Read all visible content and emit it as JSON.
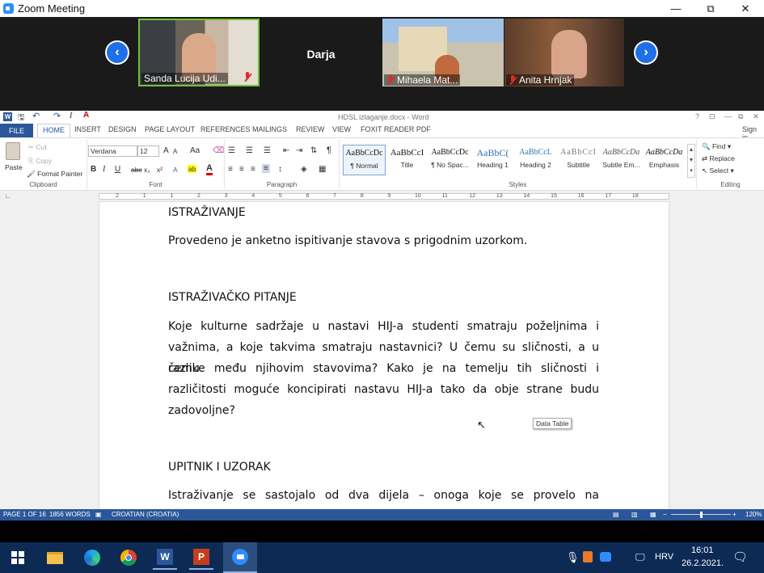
{
  "zoom": {
    "window_title": "Zoom Meeting",
    "participants": [
      {
        "name": "Sanda Lucija Udi...",
        "muted": true
      },
      {
        "name": "Darja",
        "muted": false
      },
      {
        "name": "Mihaela Mat...",
        "muted": true
      },
      {
        "name": "Anita Hrnjak",
        "muted": true
      }
    ],
    "win_controls": {
      "minimize": "—",
      "restore": "⧉",
      "close": "✕"
    }
  },
  "word": {
    "title": "HDSL izlaganje.docx - Word",
    "signin": "Sign in",
    "title_controls": {
      "help": "?",
      "ribbon_opts": "⊡",
      "minimize": "—",
      "restore": "⧉",
      "close": "✕"
    },
    "tabs": {
      "file": "FILE",
      "home": "HOME",
      "insert": "INSERT",
      "design": "DESIGN",
      "page_layout": "PAGE LAYOUT",
      "references": "REFERENCES",
      "mailings": "MAILINGS",
      "review": "REVIEW",
      "view": "VIEW",
      "foxit": "FOXIT READER PDF"
    },
    "clipboard": {
      "paste": "Paste",
      "cut": "Cut",
      "copy": "Copy",
      "format_painter": "Format Painter",
      "label": "Clipboard"
    },
    "font": {
      "name": "Verdana",
      "size": "12",
      "label": "Font",
      "grow": "A",
      "shrink": "A",
      "case": "Aa",
      "bold": "B",
      "italic": "I",
      "underline": "U",
      "strike": "abc",
      "sub": "x₂",
      "sup": "x²",
      "highlight": "ab",
      "color": "A"
    },
    "paragraph": {
      "label": "Paragraph",
      "pilcrow": "¶"
    },
    "styles": {
      "label": "Styles",
      "items": [
        {
          "preview": "AaBbCcDc",
          "name": "¶ Normal"
        },
        {
          "preview": "AaBbCcI",
          "name": "Title"
        },
        {
          "preview": "AaBbCcDc",
          "name": "¶ No Spac..."
        },
        {
          "preview": "AaBbC(",
          "name": "Heading 1"
        },
        {
          "preview": "AaBbCcL",
          "name": "Heading 2"
        },
        {
          "preview": "AaBbCcI",
          "name": "Subtitle"
        },
        {
          "preview": "AaBbCcDa",
          "name": "Subtle Em..."
        },
        {
          "preview": "AaBbCcDa",
          "name": "Emphasis"
        }
      ]
    },
    "editing": {
      "find": "Find",
      "replace": "Replace",
      "select": "Select",
      "label": "Editing"
    },
    "ruler_ticks": [
      "2",
      "1",
      "1",
      "2",
      "3",
      "4",
      "5",
      "6",
      "7",
      "8",
      "9",
      "10",
      "11",
      "12",
      "13",
      "14",
      "15",
      "16",
      "17",
      "18"
    ],
    "document": {
      "h1": "ISTRAŽIVANJE",
      "p1": "Provedeno je anketno ispitivanje stavova s prigodnim uzorkom.",
      "h2": "ISTRAŽIVAČKO PITANJE",
      "p2_lines": [
        "Koje kulturne sadržaje u nastavi HIJ-a studenti smatraju poželjnima i",
        "važnima, a koje takvima smatraju nastavnici? U čemu su sličnosti, a u čemu",
        "razlike među njihovim stavovima? Kako je na temelju tih sličnosti i",
        "različitosti moguće koncipirati nastavu HIJ-a tako da obje strane budu"
      ],
      "p2_last": "zadovoljne?",
      "h3": "UPITNIK I UZORAK",
      "p3_line": "Istraživanje se sastojalo od dva dijela – onoga koje se provelo na"
    },
    "tooltip": "Data Table",
    "status": {
      "page": "PAGE 1 OF 16",
      "words": "1856 WORDS",
      "language": "CROATIAN (CROATIA)",
      "zoom": "120%",
      "minus": "−",
      "plus": "+"
    }
  },
  "taskbar": {
    "lang": "HRV",
    "time": "16:01",
    "date": "26.2.2021.",
    "apps": [
      "windows-start",
      "file-explorer",
      "edge",
      "chrome",
      "word",
      "powerpoint",
      "zoom"
    ]
  },
  "colors": {
    "word_blue": "#2b579a",
    "zoom_blue": "#1e6fe8",
    "taskbar": "#0d2a55"
  }
}
